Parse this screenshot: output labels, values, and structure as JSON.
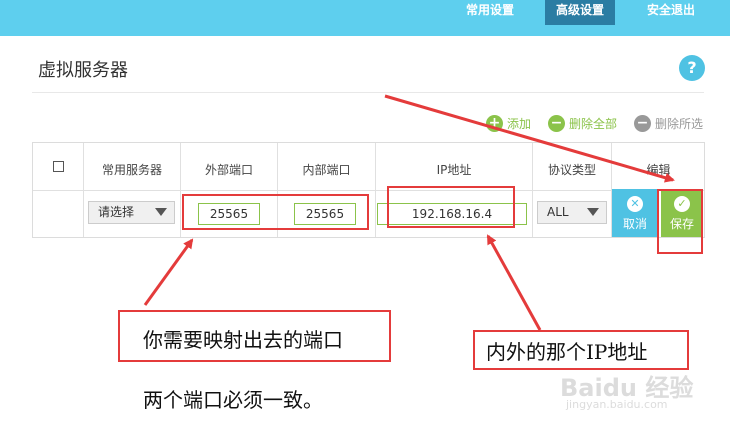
{
  "nav": {
    "common": "常用设置",
    "advanced": "高级设置",
    "logout": "安全退出"
  },
  "page": {
    "title": "虚拟服务器",
    "help": "?"
  },
  "actions": {
    "add": "添加",
    "delete_all": "删除全部",
    "delete_selected": "删除所选"
  },
  "table": {
    "headers": [
      "常用服务器",
      "外部端口",
      "内部端口",
      "IP地址",
      "协议类型",
      "编辑"
    ],
    "row": {
      "server_select": "请选择",
      "external_port": "25565",
      "internal_port": "25565",
      "ip": "192.168.16.4",
      "protocol": "ALL",
      "cancel_label": "取消",
      "save_label": "保存"
    }
  },
  "annotations": {
    "port_note": "你需要映射出去的端口",
    "port_note2": "两个端口必须一致。",
    "ip_note": "内外的那个IP地址"
  },
  "watermark": {
    "brand": "Baidu 经验",
    "url": "jingyan.baidu.com"
  },
  "colors": {
    "topbar": "#5ecfee",
    "nav_active": "#2b7da3",
    "accent_green": "#8bc34a",
    "accent_blue": "#4fc2e3",
    "annotation_red": "#e43b3b"
  }
}
